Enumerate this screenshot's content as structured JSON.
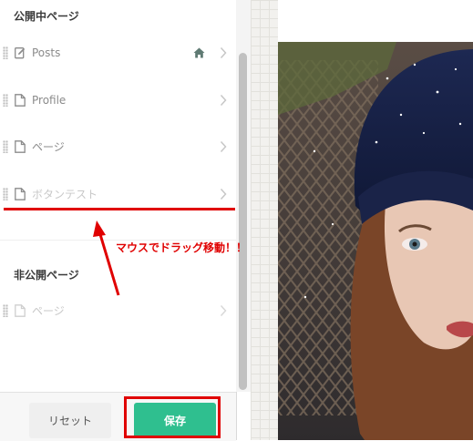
{
  "sidebar": {
    "published_title": "公開中ページ",
    "published_items": [
      {
        "label": "Posts",
        "icon": "edit-icon",
        "home": true
      },
      {
        "label": "Profile",
        "icon": "document-icon"
      },
      {
        "label": "ページ",
        "icon": "document-icon"
      },
      {
        "label": "ボタンテスト",
        "icon": "document-icon",
        "dragging": true
      }
    ],
    "unpublished_title": "非公開ページ",
    "unpublished_items": [
      {
        "label": "ページ",
        "icon": "document-icon"
      }
    ]
  },
  "footer": {
    "reset_label": "リセット",
    "save_label": "保存"
  },
  "annotation": {
    "text": "マウスでドラッグ移動！！"
  },
  "colors": {
    "accent": "#2fbf8f",
    "annotation_red": "#e00000"
  }
}
